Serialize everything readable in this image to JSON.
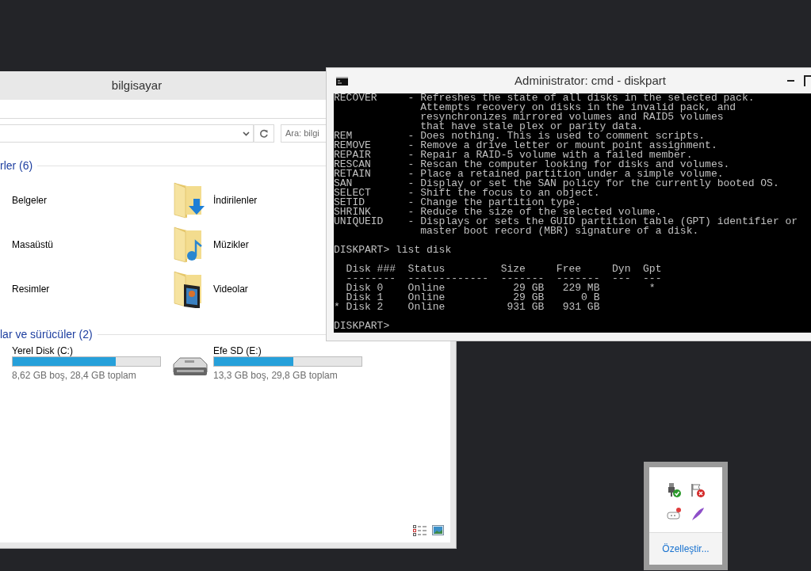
{
  "explorer": {
    "title": "bilgisayar",
    "search_placeholder": "Ara: bilgi",
    "groups": [
      {
        "header": "rler (6)",
        "kind": "folders",
        "items": [
          {
            "label": "Belgeler"
          },
          {
            "label": "İndirilenler"
          },
          {
            "label": "Masaüstü"
          },
          {
            "label": "Müzikler"
          },
          {
            "label": "Resimler"
          },
          {
            "label": "Videolar"
          }
        ]
      },
      {
        "header": "lar ve sürücüler (2)",
        "kind": "drives",
        "items": [
          {
            "label": "Yerel Disk (C:)",
            "level": 0.7,
            "caption": "8,62 GB boş, 28,4 GB toplam"
          },
          {
            "label": "Efe SD (E:)",
            "level": 0.54,
            "caption": "13,3 GB boş, 29,8 GB toplam"
          }
        ]
      }
    ]
  },
  "console": {
    "title": "Administrator: cmd - diskpart",
    "blocks": [
      [
        "RECOVER     - Refreshes the state of all disks in the selected pack.",
        "              Attempts recovery on disks in the invalid pack, and",
        "              resynchronizes mirrored volumes and RAID5 volumes",
        "              that have stale plex or parity data.",
        "REM         - Does nothing. This is used to comment scripts.",
        "REMOVE      - Remove a drive letter or mount point assignment.",
        "REPAIR      - Repair a RAID-5 volume with a failed member.",
        "RESCAN      - Rescan the computer looking for disks and volumes.",
        "RETAIN      - Place a retained partition under a simple volume.",
        "SAN         - Display or set the SAN policy for the currently booted OS.",
        "SELECT      - Shift the focus to an object.",
        "SETID       - Change the partition type.",
        "SHRINK      - Reduce the size of the selected volume.",
        "UNIQUEID    - Displays or sets the GUID partition table (GPT) identifier or",
        "              master boot record (MBR) signature of a disk."
      ],
      [
        "DISKPART> list disk"
      ],
      [
        "  Disk ###  Status         Size     Free     Dyn  Gpt",
        "  --------  -------------  -------  -------  ---  ---",
        "  Disk 0    Online           29 GB   229 MB        *",
        "  Disk 1    Online           29 GB      0 B",
        "* Disk 2    Online          931 GB   931 GB"
      ],
      [
        "DISKPART>"
      ]
    ]
  },
  "tray": {
    "link": "Özelleştir..."
  }
}
